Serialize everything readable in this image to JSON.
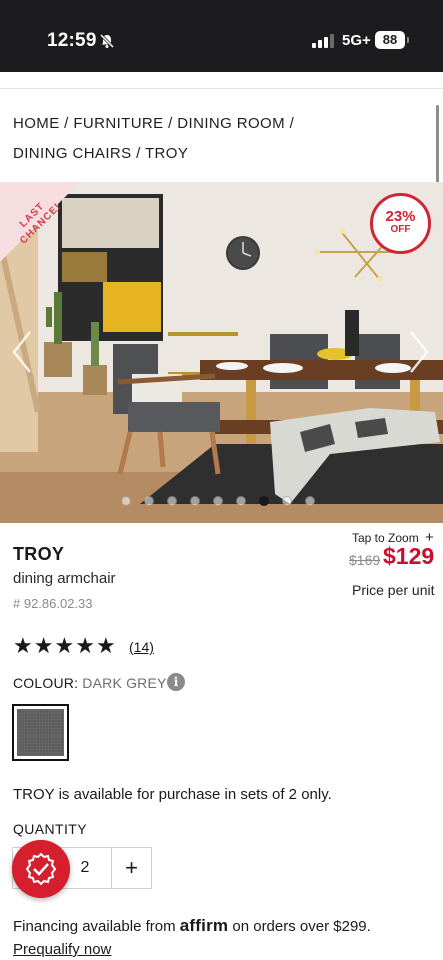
{
  "status_bar": {
    "time": "12:59",
    "network": "5G+",
    "battery": "88",
    "icons": [
      "bell-off-icon",
      "signal-icon"
    ]
  },
  "breadcrumb": [
    {
      "label": "HOME",
      "sep": " / "
    },
    {
      "label": "FURNITURE",
      "sep": " / "
    },
    {
      "label": "DINING ROOM",
      "sep": " / "
    },
    {
      "label": "DINING CHAIRS",
      "sep": "  / "
    },
    {
      "label": "TROY",
      "sep": ""
    }
  ],
  "hero": {
    "ribbon_line1": "LAST",
    "ribbon_line2": "CHANCE!",
    "discount_pct": "23%",
    "discount_off": "OFF",
    "slide_count": 9,
    "active_slide": 7,
    "colors": {
      "ribbon_text": "#d33a4c",
      "badge": "#cf2536"
    }
  },
  "product": {
    "zoom_label": "Tap to Zoom",
    "zoom_icon": "plus-icon",
    "name": "TROY",
    "description": "dining armchair",
    "sku": "# 92.86.02.33",
    "old_price": "$169",
    "new_price": "$129",
    "price_unit": "Price per unit",
    "rating": 5,
    "reviews": "(14)",
    "colour_label": "COLOUR:",
    "colour_value": "DARK GREY",
    "sets_note": "TROY is available for purchase in sets of 2 only.",
    "quantity_label": "QUANTITY",
    "quantity": "2",
    "price_color": "#c8102e"
  },
  "financing": {
    "before": "Financing available from ",
    "brand": "affirm",
    "after": " on orders over $299.",
    "link": "Prequalify now"
  }
}
